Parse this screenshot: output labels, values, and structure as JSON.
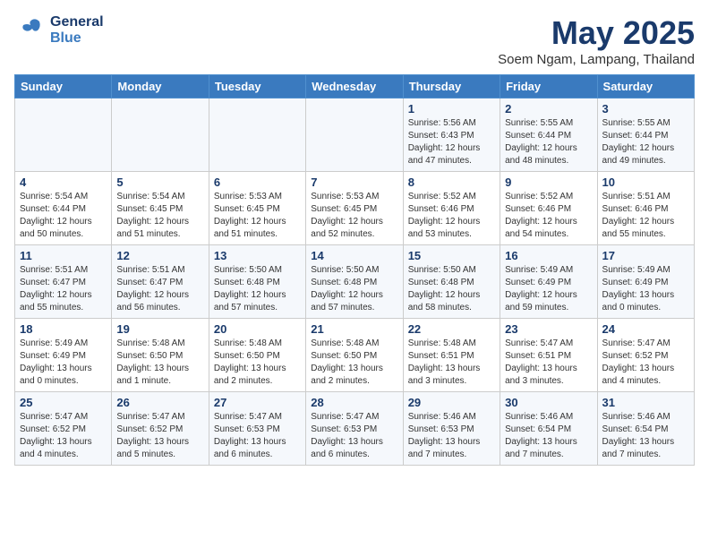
{
  "header": {
    "logo_general": "General",
    "logo_blue": "Blue",
    "month": "May 2025",
    "location": "Soem Ngam, Lampang, Thailand"
  },
  "weekdays": [
    "Sunday",
    "Monday",
    "Tuesday",
    "Wednesday",
    "Thursday",
    "Friday",
    "Saturday"
  ],
  "weeks": [
    [
      {
        "day": "",
        "info": ""
      },
      {
        "day": "",
        "info": ""
      },
      {
        "day": "",
        "info": ""
      },
      {
        "day": "",
        "info": ""
      },
      {
        "day": "1",
        "info": "Sunrise: 5:56 AM\nSunset: 6:43 PM\nDaylight: 12 hours\nand 47 minutes."
      },
      {
        "day": "2",
        "info": "Sunrise: 5:55 AM\nSunset: 6:44 PM\nDaylight: 12 hours\nand 48 minutes."
      },
      {
        "day": "3",
        "info": "Sunrise: 5:55 AM\nSunset: 6:44 PM\nDaylight: 12 hours\nand 49 minutes."
      }
    ],
    [
      {
        "day": "4",
        "info": "Sunrise: 5:54 AM\nSunset: 6:44 PM\nDaylight: 12 hours\nand 50 minutes."
      },
      {
        "day": "5",
        "info": "Sunrise: 5:54 AM\nSunset: 6:45 PM\nDaylight: 12 hours\nand 51 minutes."
      },
      {
        "day": "6",
        "info": "Sunrise: 5:53 AM\nSunset: 6:45 PM\nDaylight: 12 hours\nand 51 minutes."
      },
      {
        "day": "7",
        "info": "Sunrise: 5:53 AM\nSunset: 6:45 PM\nDaylight: 12 hours\nand 52 minutes."
      },
      {
        "day": "8",
        "info": "Sunrise: 5:52 AM\nSunset: 6:46 PM\nDaylight: 12 hours\nand 53 minutes."
      },
      {
        "day": "9",
        "info": "Sunrise: 5:52 AM\nSunset: 6:46 PM\nDaylight: 12 hours\nand 54 minutes."
      },
      {
        "day": "10",
        "info": "Sunrise: 5:51 AM\nSunset: 6:46 PM\nDaylight: 12 hours\nand 55 minutes."
      }
    ],
    [
      {
        "day": "11",
        "info": "Sunrise: 5:51 AM\nSunset: 6:47 PM\nDaylight: 12 hours\nand 55 minutes."
      },
      {
        "day": "12",
        "info": "Sunrise: 5:51 AM\nSunset: 6:47 PM\nDaylight: 12 hours\nand 56 minutes."
      },
      {
        "day": "13",
        "info": "Sunrise: 5:50 AM\nSunset: 6:48 PM\nDaylight: 12 hours\nand 57 minutes."
      },
      {
        "day": "14",
        "info": "Sunrise: 5:50 AM\nSunset: 6:48 PM\nDaylight: 12 hours\nand 57 minutes."
      },
      {
        "day": "15",
        "info": "Sunrise: 5:50 AM\nSunset: 6:48 PM\nDaylight: 12 hours\nand 58 minutes."
      },
      {
        "day": "16",
        "info": "Sunrise: 5:49 AM\nSunset: 6:49 PM\nDaylight: 12 hours\nand 59 minutes."
      },
      {
        "day": "17",
        "info": "Sunrise: 5:49 AM\nSunset: 6:49 PM\nDaylight: 13 hours\nand 0 minutes."
      }
    ],
    [
      {
        "day": "18",
        "info": "Sunrise: 5:49 AM\nSunset: 6:49 PM\nDaylight: 13 hours\nand 0 minutes."
      },
      {
        "day": "19",
        "info": "Sunrise: 5:48 AM\nSunset: 6:50 PM\nDaylight: 13 hours\nand 1 minute."
      },
      {
        "day": "20",
        "info": "Sunrise: 5:48 AM\nSunset: 6:50 PM\nDaylight: 13 hours\nand 2 minutes."
      },
      {
        "day": "21",
        "info": "Sunrise: 5:48 AM\nSunset: 6:50 PM\nDaylight: 13 hours\nand 2 minutes."
      },
      {
        "day": "22",
        "info": "Sunrise: 5:48 AM\nSunset: 6:51 PM\nDaylight: 13 hours\nand 3 minutes."
      },
      {
        "day": "23",
        "info": "Sunrise: 5:47 AM\nSunset: 6:51 PM\nDaylight: 13 hours\nand 3 minutes."
      },
      {
        "day": "24",
        "info": "Sunrise: 5:47 AM\nSunset: 6:52 PM\nDaylight: 13 hours\nand 4 minutes."
      }
    ],
    [
      {
        "day": "25",
        "info": "Sunrise: 5:47 AM\nSunset: 6:52 PM\nDaylight: 13 hours\nand 4 minutes."
      },
      {
        "day": "26",
        "info": "Sunrise: 5:47 AM\nSunset: 6:52 PM\nDaylight: 13 hours\nand 5 minutes."
      },
      {
        "day": "27",
        "info": "Sunrise: 5:47 AM\nSunset: 6:53 PM\nDaylight: 13 hours\nand 6 minutes."
      },
      {
        "day": "28",
        "info": "Sunrise: 5:47 AM\nSunset: 6:53 PM\nDaylight: 13 hours\nand 6 minutes."
      },
      {
        "day": "29",
        "info": "Sunrise: 5:46 AM\nSunset: 6:53 PM\nDaylight: 13 hours\nand 7 minutes."
      },
      {
        "day": "30",
        "info": "Sunrise: 5:46 AM\nSunset: 6:54 PM\nDaylight: 13 hours\nand 7 minutes."
      },
      {
        "day": "31",
        "info": "Sunrise: 5:46 AM\nSunset: 6:54 PM\nDaylight: 13 hours\nand 7 minutes."
      }
    ]
  ]
}
